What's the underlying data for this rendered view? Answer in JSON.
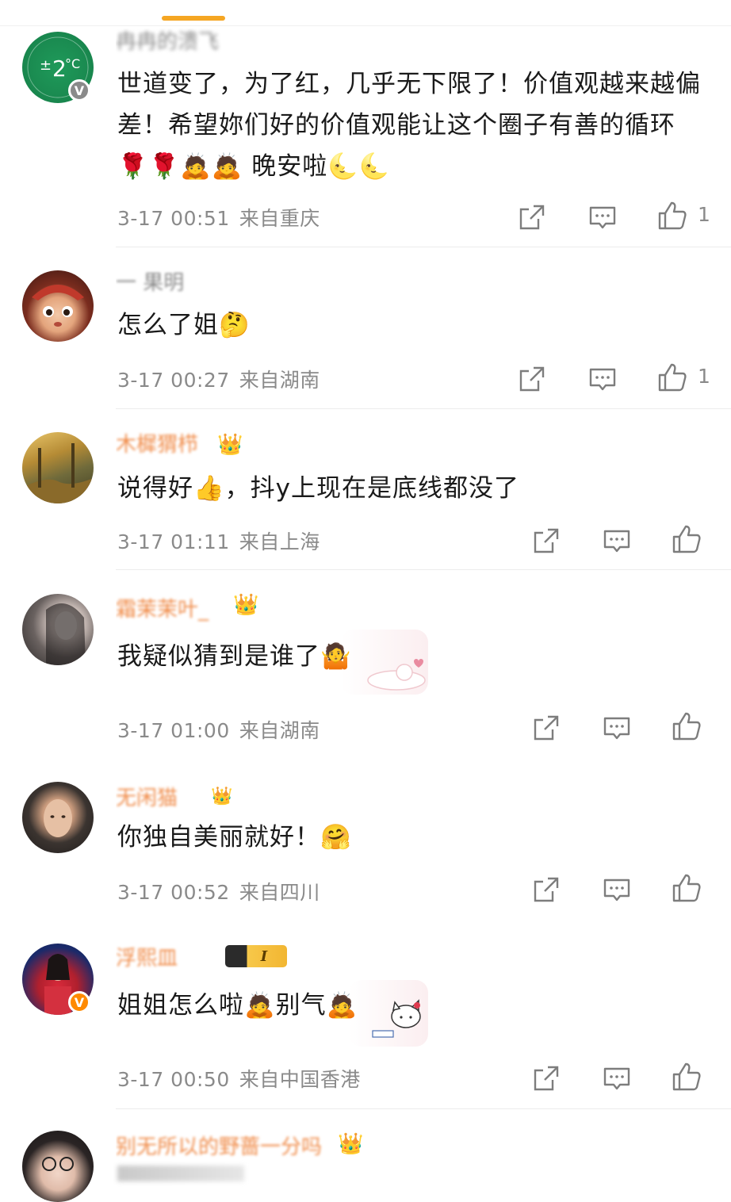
{
  "comments": [
    {
      "name": "冉冉的溃飞",
      "text": "世道变了，为了红，几乎无下限了！价值观越来越偏差！希望妳们好的价值观能让这个圈子有善的循环🌹🌹🙇🙇 晚安啦🌜🌜",
      "time": "3-17 00:51",
      "location": "来自重庆",
      "likes": "1",
      "avatar_badge": "V"
    },
    {
      "name": "一 果明",
      "text": "怎么了姐🤔",
      "time": "3-17 00:27",
      "location": "来自湖南",
      "likes": "1"
    },
    {
      "name": "木樨猬栉",
      "text": "说得好👍，抖y上现在是底线都没了",
      "time": "3-17 01:11",
      "location": "来自上海",
      "likes": ""
    },
    {
      "name": "霜茉茉叶_",
      "text": "我疑似猜到是谁了🤷",
      "time": "3-17 01:00",
      "location": "来自湖南",
      "likes": ""
    },
    {
      "name": "无闲猫",
      "text": "你独自美丽就好！🤗",
      "time": "3-17 00:52",
      "location": "来自四川",
      "likes": ""
    },
    {
      "name": "浮熙皿",
      "text": "姐姐怎么啦🙇别气🙇",
      "time": "3-17 00:50",
      "location": "来自中国香港",
      "likes": "",
      "avatar_badge": "V",
      "level_badge": "I"
    },
    {
      "name": "别无所以的野蔷一分吗",
      "text": "",
      "time": "",
      "location": "",
      "likes": ""
    }
  ],
  "icons": {
    "share": "share-icon",
    "comment": "comment-icon",
    "like": "thumbs-up-icon",
    "crown": "crown-icon"
  },
  "colors": {
    "accent": "#f5a623",
    "meta_text": "#8a8a8a",
    "verified_gray": "#8a8a8a",
    "verified_orange": "#ff8a00"
  }
}
